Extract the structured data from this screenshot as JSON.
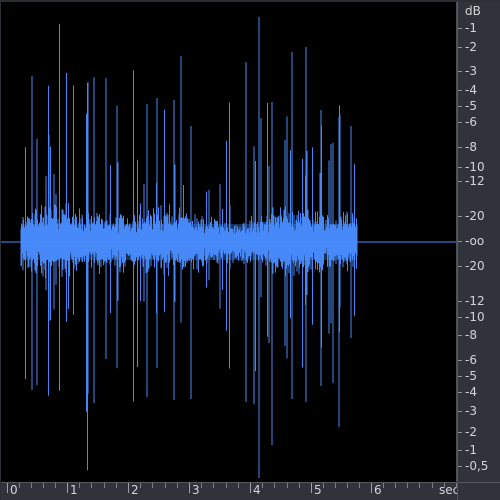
{
  "editor": {
    "view": "waveform",
    "waveform_color": "#4a8cff",
    "background_color": "#000000",
    "axis_panel_color": "#30343a"
  },
  "db_ruler": {
    "unit_label": "dB",
    "ticks_top": [
      "-1",
      "-2",
      "-3",
      "-4",
      "-5",
      "-6",
      "-8",
      "-10",
      "-12",
      "-20",
      "-oo"
    ],
    "ticks_bottom": [
      "-20",
      "-12",
      "-10",
      "-8",
      "-6",
      "-5",
      "-4",
      "-3",
      "-2",
      "-1",
      "-0,5"
    ]
  },
  "time_ruler": {
    "unit_label": "sec",
    "labels": [
      "0",
      "1",
      "2",
      "3",
      "4",
      "5",
      "6"
    ]
  },
  "chart_data": {
    "type": "line",
    "title": "",
    "xlabel": "sec",
    "ylabel": "dB",
    "xlim": [
      0,
      7.2
    ],
    "ylim": [
      -1,
      1
    ],
    "grid": false,
    "series": [
      {
        "values": "audio waveform centered at -oo dB between approximately 0.25 and 5.75 sec"
      }
    ]
  }
}
